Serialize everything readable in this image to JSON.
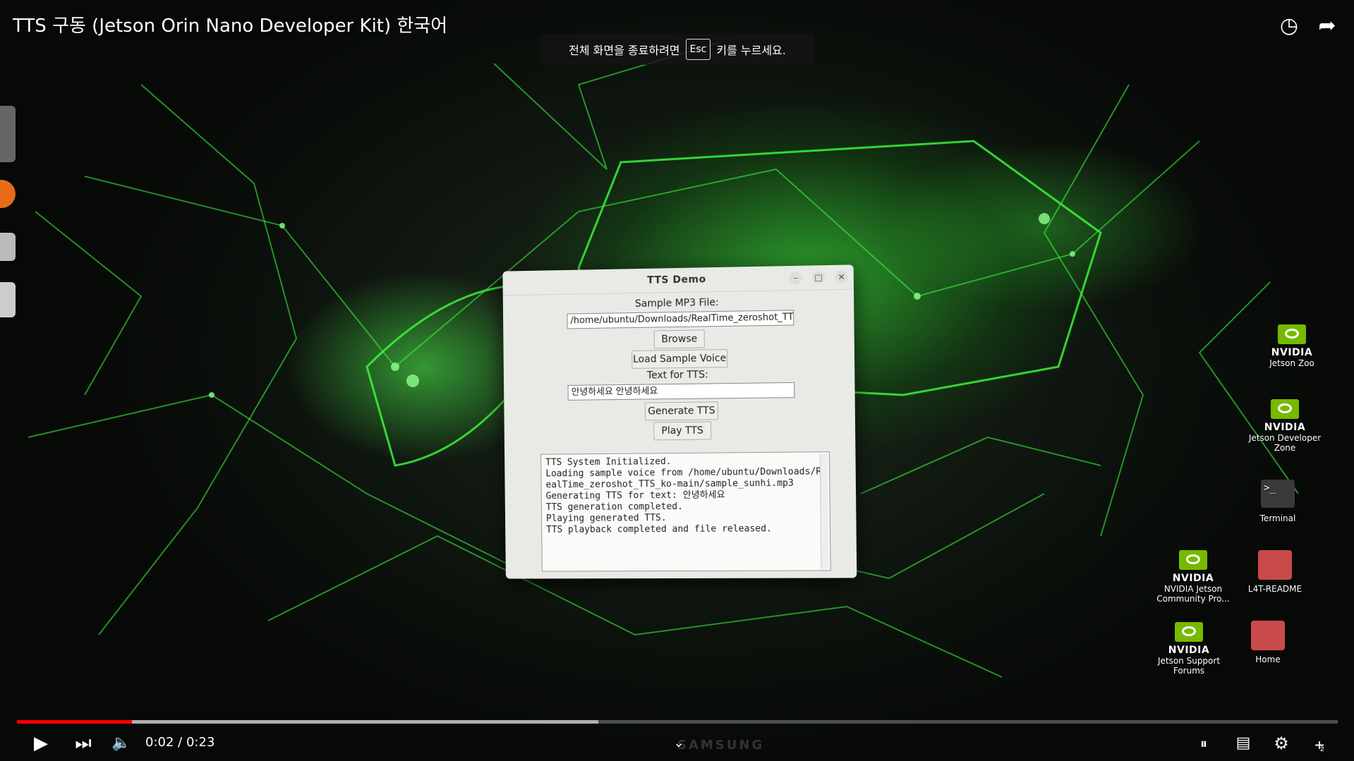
{
  "video": {
    "title": "TTS 구동 (Jetson Orin Nano Developer Kit) 한국어",
    "current_time": "0:02",
    "separator": "/",
    "duration": "0:23",
    "progress": 0.087,
    "buffered": 0.44
  },
  "fullscreen_toast": {
    "before": "전체 화면을 종료하려면",
    "key": "Esc",
    "after": "키를 누르세요."
  },
  "dialog": {
    "title": "TTS Demo",
    "sample_label": "Sample MP3 File:",
    "sample_path": "/home/ubuntu/Downloads/RealTime_zeroshot_TTS",
    "browse_label": "Browse",
    "load_label": "Load Sample Voice",
    "text_label": "Text for TTS:",
    "text_value": "안녕하세요 안녕하세요",
    "generate_label": "Generate TTS",
    "play_label": "Play TTS",
    "log_lines": [
      "TTS System Initialized.",
      "Loading sample voice from /home/ubuntu/Downloads/R",
      "ealTime_zeroshot_TTS_ko-main/sample_sunhi.mp3",
      "Generating TTS for text: 안녕하세요",
      "TTS generation completed.",
      "Playing generated TTS.",
      "TTS playback completed and file released."
    ]
  },
  "desktop_icons": {
    "jetson_zoo": {
      "brand": "NVIDIA",
      "label": "Jetson Zoo"
    },
    "dev_zone": {
      "brand": "NVIDIA",
      "label1": "Jetson Developer",
      "label2": "Zone"
    },
    "terminal": {
      "glyph": ">_",
      "label": "Terminal"
    },
    "community": {
      "brand": "NVIDIA",
      "label1": "NVIDIA Jetson",
      "label2": "Community Pro..."
    },
    "readme": {
      "label": "L4T-README"
    },
    "support": {
      "brand": "NVIDIA",
      "label1": "Jetson Support",
      "label2": "Forums"
    },
    "home": {
      "label": "Home"
    }
  },
  "monitor_brand": "SAMSUNG",
  "colors": {
    "accent": "#76b900",
    "progress": "#ff0000"
  }
}
